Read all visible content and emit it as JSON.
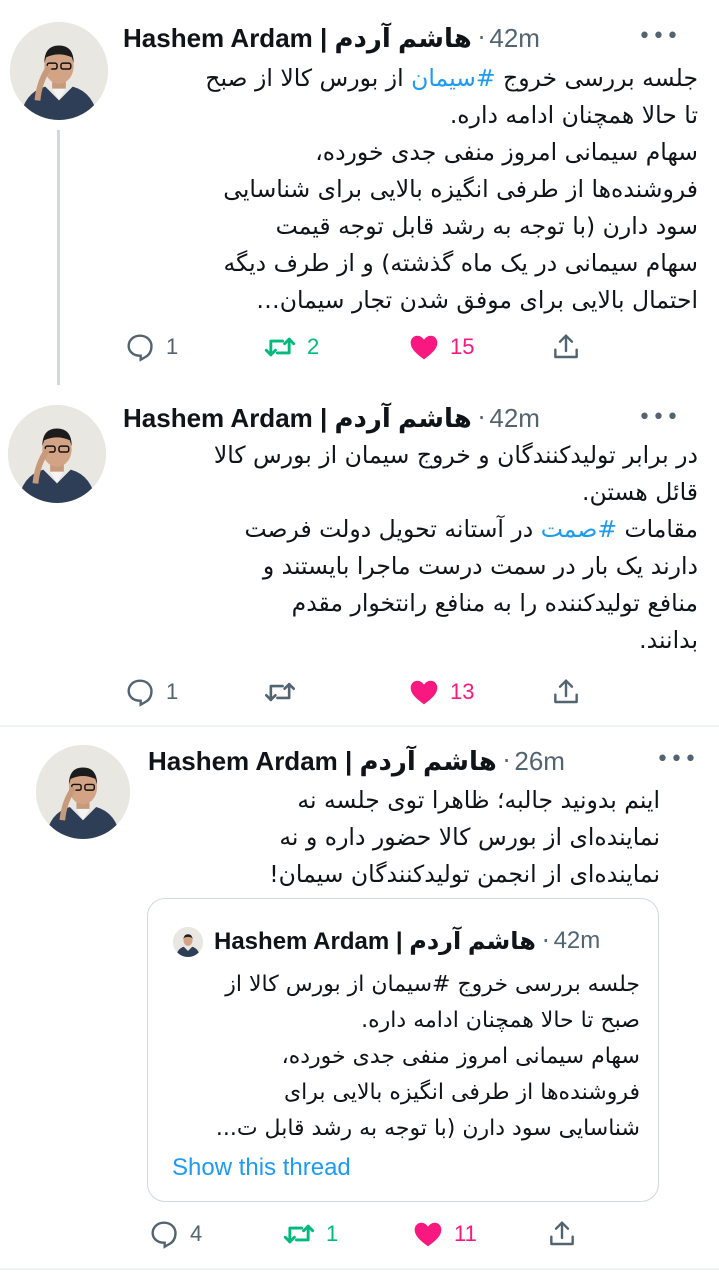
{
  "accent_color": "#1d9bf0",
  "tweets": [
    {
      "author": "Hashem Ardam | هاشم آردم",
      "time": "42m",
      "more": "•••",
      "lines": [
        "جلسه بررسی خروج #سیمان از بورس کالا از صبح",
        "تا حالا همچنان ادامه داره.",
        "سهام سیمانی امروز منفی جدی خورده،",
        "فروشنده‌ها از طرفی انگیزه بالایی برای شناسایی",
        "سود دارن (با توجه به رشد قابل توجه قیمت",
        "سهام سیمانی در یک ماه گذشته) و از طرف دیگه",
        "احتمال بالایی برای موفق شدن تجار سیمان…"
      ],
      "replies": "1",
      "retweets": "2",
      "likes": "15"
    },
    {
      "author": "Hashem Ardam | هاشم آردم",
      "time": "42m",
      "more": "•••",
      "lines": [
        "در برابر تولیدکنندگان و خروج سیمان از بورس کالا",
        "قائل هستن.",
        "مقامات #صمت در آستانه تحویل دولت فرصت",
        "دارند یک بار در سمت درست ماجرا بایستند و",
        "منافع تولیدکننده را به منافع رانتخوار مقدم",
        "بدانند."
      ],
      "replies": "1",
      "retweets": "",
      "likes": "13"
    },
    {
      "author": "Hashem Ardam | هاشم آردم",
      "time": "26m",
      "more": "•••",
      "lines": [
        "اینم بدونید جالبه؛ ظاهرا توی جلسه نه",
        "نماینده‌ای از بورس کالا حضور داره و نه",
        "نماینده‌ای از انجمن تولیدکنندگان سیمان!"
      ],
      "replies": "4",
      "retweets": "1",
      "likes": "11",
      "quote": {
        "author": "Hashem Ardam | هاشم آردم",
        "time": "42m",
        "lines": [
          "جلسه بررسی خروج #سیمان از بورس کالا از",
          "صبح تا حالا همچنان ادامه داره.",
          "سهام سیمانی امروز منفی جدی خورده،",
          "فروشنده‌ها از طرفی انگیزه بالایی برای",
          "شناسایی سود دارن (با توجه به رشد قابل ت..."
        ],
        "show_thread": "Show this thread"
      }
    }
  ]
}
